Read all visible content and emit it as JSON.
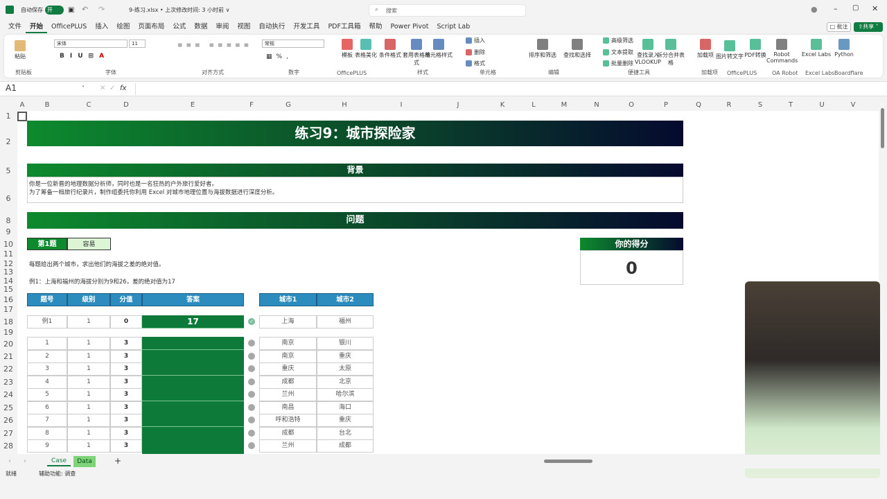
{
  "titlebar": {
    "autosave_label": "自动保存",
    "autosave_state": "开",
    "filename": "9-练习.xlsx • 上次修改时间: 3 小时前 ∨",
    "search_placeholder": "搜索"
  },
  "menu": [
    "文件",
    "开始",
    "OfficePLUS",
    "插入",
    "绘图",
    "页面布局",
    "公式",
    "数据",
    "审阅",
    "视图",
    "自动执行",
    "开发工具",
    "PDF工具箱",
    "帮助",
    "Power Pivot",
    "Script Lab"
  ],
  "menu_active": "开始",
  "actions": {
    "comment": "批注",
    "share": "共享"
  },
  "ribbon": {
    "font_name": "宋体",
    "font_size": "11",
    "number_format": "常规",
    "buttons": [
      "粘贴",
      "模板",
      "表格美化",
      "条件格式",
      "套用表格格式",
      "单元格样式",
      "插入",
      "删除",
      "格式",
      "排序和筛选",
      "查找和选择",
      "高级筛选",
      "文本提取",
      "批量删除",
      "查找录入VLOOKUP",
      "拆分合并表格",
      "加载项",
      "图片转文字",
      "PDF转换",
      "Robot Commands",
      "Excel Labs",
      "Python"
    ],
    "groups": [
      "剪贴板",
      "字体",
      "对齐方式",
      "数字",
      "OfficePLUS",
      "样式",
      "单元格",
      "编辑",
      "便捷工具",
      "加载项",
      "OfficePLUS",
      "OA Robot",
      "Excel Labs",
      "Boardflare"
    ]
  },
  "formula_bar": {
    "name_box": "A1",
    "fx": "fx",
    "value": ""
  },
  "columns": [
    "A",
    "B",
    "C",
    "D",
    "E",
    "F",
    "G",
    "H",
    "I",
    "J",
    "K",
    "L",
    "M",
    "N",
    "O",
    "P",
    "Q",
    "R",
    "S",
    "T",
    "U",
    "V"
  ],
  "rows": [
    "1",
    "2",
    "5",
    "6",
    "8",
    "9",
    "10",
    "11",
    "12",
    "13",
    "14",
    "15",
    "16",
    "17",
    "18",
    "19",
    "20",
    "21",
    "22",
    "23",
    "24",
    "25",
    "26",
    "27",
    "28"
  ],
  "sheet": {
    "title": "练习9：城市探险家",
    "background_header": "背景",
    "background_lines": [
      "你是一位新晋的地理数据分析师，同时也是一名狂热的户外旅行爱好者。",
      "为了筹备一档旅行纪录片，制作组委托你利用 Excel 对城市地理位置与海拔数据进行深度分析。"
    ],
    "question_header": "问题",
    "q_label": "第1题",
    "q_level": "容易",
    "score_label": "你的得分",
    "score": "0",
    "instruction": "每题给出两个城市，求出他们的海拔之差的绝对值。",
    "example_text": "例1：上海和福州的海拔分别为9和26，差的绝对值为17",
    "table_headers": [
      "题号",
      "级别",
      "分值",
      "答案"
    ],
    "city_headers": [
      "城市1",
      "城市2"
    ],
    "example_row": {
      "id": "例1",
      "level": "1",
      "points": "0",
      "answer": "17",
      "city1": "上海",
      "city2": "福州"
    },
    "rows": [
      {
        "id": "1",
        "level": "1",
        "points": "3",
        "city1": "南京",
        "city2": "银川"
      },
      {
        "id": "2",
        "level": "1",
        "points": "3",
        "city1": "南京",
        "city2": "重庆"
      },
      {
        "id": "3",
        "level": "1",
        "points": "3",
        "city1": "重庆",
        "city2": "太原"
      },
      {
        "id": "4",
        "level": "1",
        "points": "3",
        "city1": "成都",
        "city2": "北京"
      },
      {
        "id": "5",
        "level": "1",
        "points": "3",
        "city1": "兰州",
        "city2": "哈尔滨"
      },
      {
        "id": "6",
        "level": "1",
        "points": "3",
        "city1": "南昌",
        "city2": "海口"
      },
      {
        "id": "7",
        "level": "1",
        "points": "3",
        "city1": "呼和浩特",
        "city2": "重庆"
      },
      {
        "id": "8",
        "level": "1",
        "points": "3",
        "city1": "成都",
        "city2": "台北"
      },
      {
        "id": "9",
        "level": "1",
        "points": "3",
        "city1": "兰州",
        "city2": "成都"
      }
    ]
  },
  "sheet_tabs": [
    "Case",
    "Data"
  ],
  "active_tab": "Data",
  "status": {
    "ready": "就绪",
    "accessibility": "辅助功能: 调查"
  },
  "colors": {
    "green": "#107c41",
    "table_blue": "#2b8cbd",
    "answer_green": "#0e7a3a"
  }
}
